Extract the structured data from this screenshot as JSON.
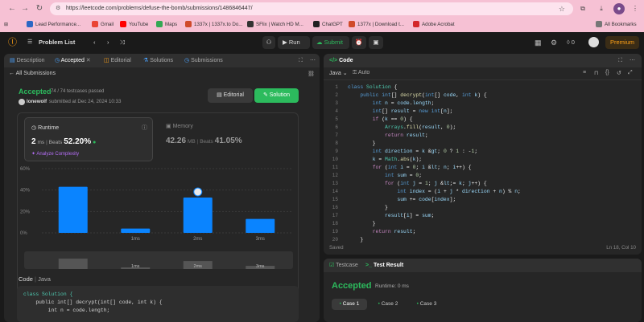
{
  "browser": {
    "url": "https://leetcode.com/problems/defuse-the-bomb/submissions/1486846447/",
    "bookmarks": [
      {
        "label": "Lead Performance...",
        "color": "#2b67c4"
      },
      {
        "label": "Gmail",
        "color": "#ea4335"
      },
      {
        "label": "YouTube",
        "color": "#ff0000"
      },
      {
        "label": "Maps",
        "color": "#34a853"
      },
      {
        "label": "1337x | 1337x.to Do...",
        "color": "#d04a2a"
      },
      {
        "label": "SFlix | Watch HD M...",
        "color": "#333333"
      },
      {
        "label": "ChatGPT",
        "color": "#222222"
      },
      {
        "label": "1377x | Download t...",
        "color": "#d04a2a"
      },
      {
        "label": "Adobe Acrobat",
        "color": "#d3272b"
      }
    ],
    "all_bookmarks": "All Bookmarks"
  },
  "lc_header": {
    "problem_list": "Problem List",
    "run": "Run",
    "submit": "Submit",
    "streak": "0",
    "premium": "Premium"
  },
  "left_tabs": [
    "Description",
    "Accepted",
    "Editorial",
    "Solutions",
    "Submissions"
  ],
  "submission": {
    "all_submissions": "All Submissions",
    "status": "Accepted",
    "testcases": "74 / 74 testcases passed",
    "user": "lonewolf",
    "submitted_at": "submitted at Dec 24, 2024 10:33",
    "editorial_btn": "Editorial",
    "solution_btn": "Solution",
    "runtime_label": "Runtime",
    "runtime_value": "2",
    "runtime_unit": "ms",
    "beats_label": "Beats",
    "runtime_beats": "52.20%",
    "analyze": "Analyze Complexity",
    "memory_label": "Memory",
    "memory_value": "42.26",
    "memory_unit": "MB",
    "memory_beats": "41.05%"
  },
  "chart_data": {
    "type": "bar",
    "categories": [
      "",
      "1ms",
      "2ms",
      "3ms"
    ],
    "values": [
      43,
      4,
      33,
      13
    ],
    "ylim": [
      0,
      60
    ],
    "yticks": [
      "60%",
      "40%",
      "20%",
      "0%"
    ],
    "highlight_index": 2,
    "overview_labels": [
      "1ms",
      "2ms",
      "3ms"
    ],
    "color": "#0a84ff"
  },
  "code_section": {
    "label": "Code",
    "lang": "Java",
    "preview": [
      "class Solution {",
      "    public int[] decrypt(int[] code, int k) {",
      "        int n = code.length;"
    ]
  },
  "editor": {
    "title": "Code",
    "lang": "Java",
    "mode": "Auto",
    "saved": "Saved",
    "cursor": "Ln 18, Col 10",
    "lines": [
      "class Solution {",
      "    public int[] decrypt(int[] code, int k) {",
      "        int n = code.length;",
      "        int[] result = new int[n];",
      "        if (k == 0) {",
      "            Arrays.fill(result, 0);",
      "            return result;",
      "        }",
      "        int direction = k > 0 ? 1 : -1;",
      "        k = Math.abs(k);",
      "        for (int i = 0; i < n; i++) {",
      "            int sum = 0;",
      "            for (int j = 1; j <= k; j++) {",
      "                int index = (i + j * direction + n) % n;",
      "                sum += code[index];",
      "            }",
      "            result[i] = sum;",
      "        }",
      "        return result;",
      "    }"
    ]
  },
  "result_panel": {
    "testcase_tab": "Testcase",
    "result_tab": "Test Result",
    "status": "Accepted",
    "runtime": "Runtime: 0 ms",
    "cases": [
      "Case 1",
      "Case 2",
      "Case 3"
    ]
  }
}
